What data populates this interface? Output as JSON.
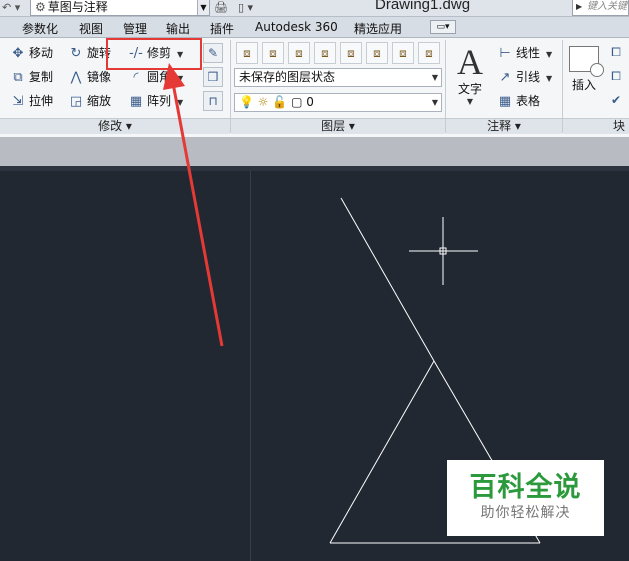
{
  "titlebar": {
    "workspace": "草图与注释",
    "document_title": "Drawing1.dwg",
    "help_search_placeholder": "键入关键"
  },
  "tabs": [
    "参数化",
    "视图",
    "管理",
    "输出",
    "插件",
    "Autodesk 360",
    "精选应用"
  ],
  "ribbon": {
    "modify": {
      "move": "移动",
      "rotate": "旋转",
      "trim": "修剪",
      "copy": "复制",
      "mirror": "镜像",
      "fillet": "圆角",
      "stretch": "拉伸",
      "scale": "缩放",
      "array": "阵列",
      "panel_label": "修改"
    },
    "layers": {
      "layer_state": "未保存的图层状态",
      "current_layer": "0",
      "panel_label": "图层"
    },
    "annotation": {
      "text": "文字",
      "linear": "线性",
      "leader": "引线",
      "table": "表格",
      "panel_label": "注释"
    },
    "block": {
      "insert": "插入",
      "panel_label": "块"
    }
  },
  "watermark": {
    "title": "百科全说",
    "subtitle": "助你轻松解决"
  },
  "colors": {
    "highlight": "#e53935",
    "canvas_bg": "#222831",
    "watermark_green": "#2c9a3c"
  }
}
